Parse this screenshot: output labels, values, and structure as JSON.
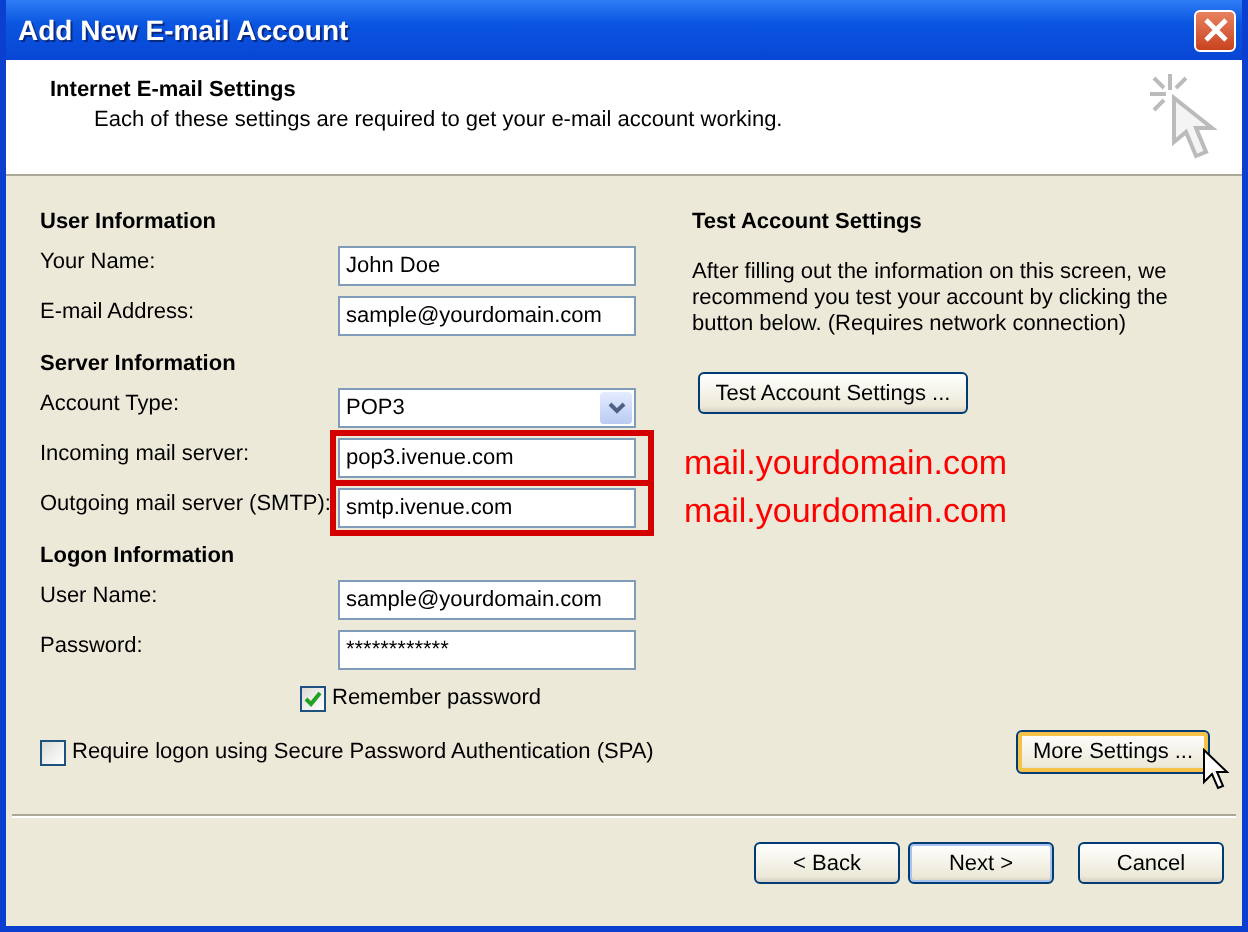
{
  "window": {
    "title": "Add New E-mail Account"
  },
  "header": {
    "title": "Internet E-mail Settings",
    "subtitle": "Each of these settings are required to get your e-mail account working."
  },
  "sections": [
    {
      "heading": "User Information",
      "fields": [
        {
          "kind": "text",
          "label": "Your Name:",
          "value": "John Doe",
          "highlighted": false
        },
        {
          "kind": "text",
          "label": "E-mail Address:",
          "value": "sample@yourdomain.com",
          "highlighted": false
        }
      ]
    },
    {
      "heading": "Server Information",
      "fields": [
        {
          "kind": "dropdown",
          "label": "Account Type:",
          "value": "POP3",
          "highlighted": false
        },
        {
          "kind": "text",
          "label": "Incoming mail server:",
          "value": "pop3.ivenue.com",
          "highlighted": true
        },
        {
          "kind": "text",
          "label": "Outgoing mail server (SMTP):",
          "value": "smtp.ivenue.com",
          "highlighted": true
        }
      ]
    },
    {
      "heading": "Logon Information",
      "fields": [
        {
          "kind": "text",
          "label": "User Name:",
          "value": "sample@yourdomain.com",
          "highlighted": false
        },
        {
          "kind": "password",
          "label": "Password:",
          "value": "************",
          "highlighted": false
        }
      ]
    }
  ],
  "remember_password": {
    "label": "Remember password",
    "checked": true
  },
  "spa": {
    "label": "Require logon using Secure Password Authentication (SPA)",
    "checked": false
  },
  "test": {
    "heading": "Test Account Settings",
    "text": "After filling out the information on this screen, we recommend you test your account by clicking the button below. (Requires network connection)",
    "button": "Test Account Settings ..."
  },
  "annotations": [
    "mail.yourdomain.com",
    "mail.yourdomain.com"
  ],
  "more_settings": {
    "label": "More Settings ...",
    "focused": true
  },
  "buttons": [
    {
      "label": "< Back",
      "default": false
    },
    {
      "label": "Next >",
      "default": true
    },
    {
      "label": "Cancel",
      "default": false
    }
  ]
}
